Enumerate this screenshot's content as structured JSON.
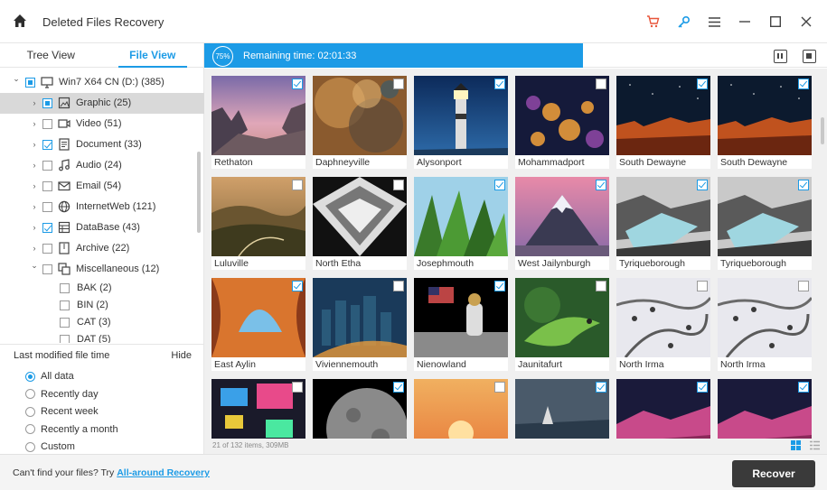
{
  "titlebar": {
    "title": "Deleted Files Recovery",
    "icons": [
      "home-icon",
      "cart-icon",
      "key-icon",
      "menu-icon",
      "minimize-icon",
      "maximize-icon",
      "close-icon"
    ]
  },
  "tabs": [
    {
      "label": "Tree View",
      "active": false
    },
    {
      "label": "File View",
      "active": true
    }
  ],
  "tree": [
    {
      "label": "Win7 X64 CN (D:) (385)",
      "icon": "computer-icon",
      "check": "partial",
      "expanded": true,
      "level": 0
    },
    {
      "label": "Graphic (25)",
      "icon": "graphic-icon",
      "check": "partial",
      "expanded": false,
      "level": 1,
      "selected": true
    },
    {
      "label": "Video (51)",
      "icon": "video-icon",
      "check": "none",
      "expanded": false,
      "level": 1
    },
    {
      "label": "Document (33)",
      "icon": "document-icon",
      "check": "checked",
      "expanded": false,
      "level": 1
    },
    {
      "label": "Audio (24)",
      "icon": "audio-icon",
      "check": "none",
      "expanded": false,
      "level": 1
    },
    {
      "label": "Email (54)",
      "icon": "email-icon",
      "check": "none",
      "expanded": false,
      "level": 1
    },
    {
      "label": "InternetWeb (121)",
      "icon": "globe-icon",
      "check": "none",
      "expanded": false,
      "level": 1
    },
    {
      "label": "DataBase (43)",
      "icon": "database-icon",
      "check": "checked",
      "expanded": false,
      "level": 1
    },
    {
      "label": "Archive (22)",
      "icon": "archive-icon",
      "check": "none",
      "expanded": false,
      "level": 1
    },
    {
      "label": "Miscellaneous (12)",
      "icon": "misc-icon",
      "check": "none",
      "expanded": true,
      "level": 1
    },
    {
      "label": "BAK (2)",
      "check": "none",
      "level": 2
    },
    {
      "label": "BIN (2)",
      "check": "none",
      "level": 2
    },
    {
      "label": "CAT (3)",
      "check": "none",
      "level": 2
    },
    {
      "label": "DAT (5)",
      "check": "none",
      "level": 2
    }
  ],
  "filter": {
    "title": "Last modified file time",
    "hide_label": "Hide",
    "options": [
      {
        "label": "All data",
        "selected": true
      },
      {
        "label": "Recently day",
        "selected": false
      },
      {
        "label": "Recent week",
        "selected": false
      },
      {
        "label": "Recently a month",
        "selected": false
      },
      {
        "label": "Custom",
        "selected": false
      }
    ]
  },
  "progress": {
    "percent_label": "75%",
    "percent": 75,
    "remaining": "Remaining time: 02:01:33"
  },
  "files": [
    {
      "name": "Rethaton",
      "checked": true,
      "scene": "canyon"
    },
    {
      "name": "Daphneyville",
      "checked": false,
      "scene": "nebula"
    },
    {
      "name": "Alysonport",
      "checked": true,
      "scene": "lighthouse"
    },
    {
      "name": "Mohammadport",
      "checked": false,
      "scene": "citynight"
    },
    {
      "name": "South Dewayne",
      "checked": true,
      "scene": "redrock"
    },
    {
      "name": "South Dewayne",
      "checked": true,
      "scene": "redrock"
    },
    {
      "name": "Luluville",
      "checked": false,
      "scene": "hills"
    },
    {
      "name": "North Etha",
      "checked": false,
      "scene": "building"
    },
    {
      "name": "Josephmouth",
      "checked": true,
      "scene": "plants"
    },
    {
      "name": "West Jailynburgh",
      "checked": true,
      "scene": "mountain"
    },
    {
      "name": "Tyriqueborough",
      "checked": true,
      "scene": "glacier"
    },
    {
      "name": "Tyriqueborough",
      "checked": true,
      "scene": "glacier"
    },
    {
      "name": "East Aylin",
      "checked": true,
      "scene": "arch"
    },
    {
      "name": "Viviennemouth",
      "checked": false,
      "scene": "skyline"
    },
    {
      "name": "Nienowland",
      "checked": true,
      "scene": "moonwalk"
    },
    {
      "name": "Jaunitafurt",
      "checked": false,
      "scene": "iguana"
    },
    {
      "name": "North Irma",
      "checked": false,
      "scene": "snowroad"
    },
    {
      "name": "North Irma",
      "checked": false,
      "scene": "snowroad"
    },
    {
      "name": "",
      "checked": false,
      "scene": "tokyo"
    },
    {
      "name": "",
      "checked": true,
      "scene": "moon"
    },
    {
      "name": "",
      "checked": false,
      "scene": "sunset"
    },
    {
      "name": "",
      "checked": true,
      "scene": "sea"
    },
    {
      "name": "",
      "checked": true,
      "scene": "pinkmtn"
    },
    {
      "name": "",
      "checked": true,
      "scene": "pinkmtn"
    }
  ],
  "status": {
    "items_info": "21 of 132 items, 309MB"
  },
  "footer": {
    "prompt": "Can't find your files? Try ",
    "link": "All-around Recovery",
    "recover_label": "Recover"
  },
  "colors": {
    "accent": "#1c9be6",
    "recover_bg": "#3a3a3a",
    "cart": "#e8553a"
  }
}
